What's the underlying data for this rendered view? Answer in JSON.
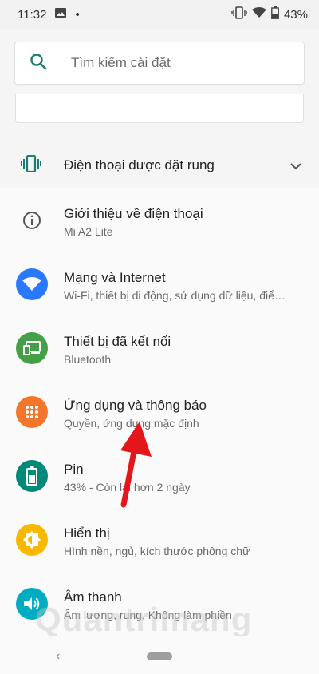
{
  "status_bar": {
    "time": "11:32",
    "battery": "43%",
    "dot": "•"
  },
  "search": {
    "placeholder": "Tìm kiếm cài đặt"
  },
  "condition": {
    "label": "Điện thoại được đặt rung"
  },
  "items": [
    {
      "title": "Giới thiệu về điện thoại",
      "subtitle": "Mi A2 Lite",
      "icon": "info-icon",
      "color": "none"
    },
    {
      "title": "Mạng và Internet",
      "subtitle": "Wi-Fi, thiết bị di động, sử dụng dữ liệu, điể…",
      "icon": "wifi-icon",
      "color": "#2979FF"
    },
    {
      "title": "Thiết bị đã kết nối",
      "subtitle": "Bluetooth",
      "icon": "devices-icon",
      "color": "#43A047"
    },
    {
      "title": "Ứng dụng và thông báo",
      "subtitle": "Quyền, ứng dụng mặc định",
      "icon": "apps-icon",
      "color": "#F4762A"
    },
    {
      "title": "Pin",
      "subtitle": "43% - Còn lại hơn 2 ngày",
      "icon": "battery-icon",
      "color": "#00897B"
    },
    {
      "title": "Hiển thị",
      "subtitle": "Hình nền, ngủ, kích thước phông chữ",
      "icon": "display-icon",
      "color": "#F9B800"
    },
    {
      "title": "Âm thanh",
      "subtitle": "Âm lượng, rung, Không làm phiền",
      "icon": "sound-icon",
      "color": "#00ACC1"
    }
  ],
  "watermark": "Quantrimang",
  "colors": {
    "accent": "#1B7E6E",
    "arrow": "#E5161B"
  }
}
